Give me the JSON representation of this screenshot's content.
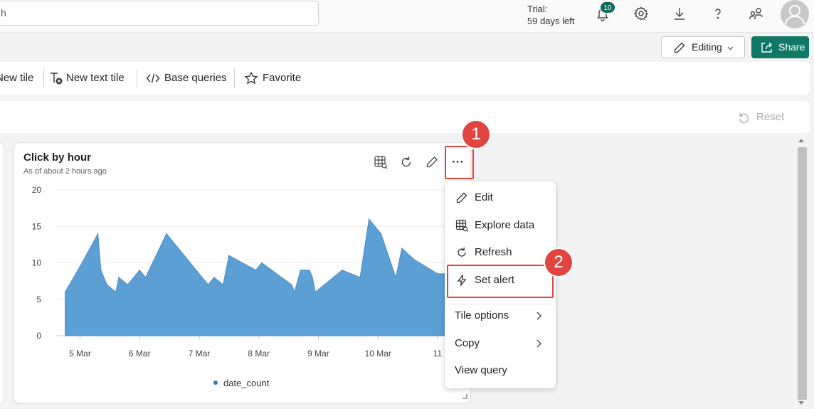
{
  "topbar": {
    "search_value": "h",
    "trial_line1": "Trial:",
    "trial_line2": "59 days left",
    "notification_count": "10",
    "icons": [
      "bell-icon",
      "gear-icon",
      "download-icon",
      "help-icon",
      "people-icon",
      "avatar-icon"
    ]
  },
  "actions": {
    "editing_label": "Editing",
    "share_label": "Share"
  },
  "toolbar": {
    "new_tile": "New tile",
    "new_text_tile": "New text tile",
    "base_queries": "Base queries",
    "favorite": "Favorite"
  },
  "params": {
    "reset_label": "Reset"
  },
  "tile": {
    "title": "Click by hour",
    "subtitle": "As of about 2 hours ago",
    "more_label": "···"
  },
  "chart_data": {
    "type": "area",
    "x_tick_labels": [
      "5 Mar",
      "6 Mar",
      "7 Mar",
      "8 Mar",
      "9 Mar",
      "10 Mar",
      "11"
    ],
    "y_ticks": [
      "0",
      "5",
      "10",
      "15",
      "20"
    ],
    "ylim": [
      0,
      20
    ],
    "series": [
      {
        "name": "date_count",
        "color": "#5b9fd4",
        "x": [
          4.75,
          5.0,
          5.3,
          5.35,
          5.45,
          5.6,
          5.65,
          5.8,
          6.0,
          6.1,
          6.45,
          7.15,
          7.25,
          7.4,
          7.5,
          7.95,
          8.05,
          8.55,
          8.6,
          8.7,
          8.85,
          8.9,
          8.95,
          9.4,
          9.7,
          9.85,
          10.05,
          10.3,
          10.4,
          10.6,
          11.0,
          11.12
        ],
        "y": [
          6,
          9.5,
          14,
          9,
          7,
          6,
          8,
          7,
          9,
          8,
          14,
          7,
          8,
          7,
          11,
          9,
          10,
          7,
          6,
          9,
          9,
          8,
          6,
          9,
          8,
          16,
          14,
          8,
          12,
          10.5,
          8.5,
          8.5
        ]
      }
    ],
    "legend": [
      "date_count"
    ],
    "legend_position": "bottom",
    "grid": true
  },
  "menu": {
    "items": [
      {
        "label": "Edit",
        "icon": "pencil-icon"
      },
      {
        "label": "Explore data",
        "icon": "table-explore-icon"
      },
      {
        "label": "Refresh",
        "icon": "refresh-icon"
      },
      {
        "label": "Set alert",
        "icon": "lightning-icon"
      },
      {
        "label": "Tile options",
        "icon": "chevron-right-icon"
      },
      {
        "label": "Copy",
        "icon": "chevron-right-icon"
      },
      {
        "label": "View query",
        "icon": ""
      }
    ]
  },
  "callouts": {
    "first": "1",
    "second": "2"
  },
  "colors": {
    "accent": "#117865",
    "callout": "#e0463f",
    "area_fill": "#5b9fd4"
  }
}
